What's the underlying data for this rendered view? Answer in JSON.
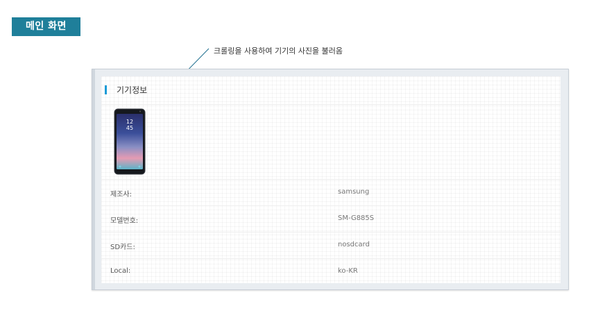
{
  "main_label": "메인 화면",
  "annotation": "크롤링을 사용하여 기기의 사진을 불러옴",
  "panel": {
    "title": "기기정보",
    "device_image_name": "phone-image",
    "phone_screen": {
      "time_hour": "12",
      "time_min": "45"
    },
    "rows": [
      {
        "label": "제조사:",
        "value": "samsung"
      },
      {
        "label": "모델번호:",
        "value": "SM-G885S"
      },
      {
        "label": "SD카드:",
        "value": "nosdcard"
      },
      {
        "label": "Local:",
        "value": "ko-KR"
      }
    ]
  },
  "colors": {
    "main_tag_bg": "#1f7f9a",
    "accent": "#1a9bd7",
    "callout_line": "#1f6f8f"
  }
}
